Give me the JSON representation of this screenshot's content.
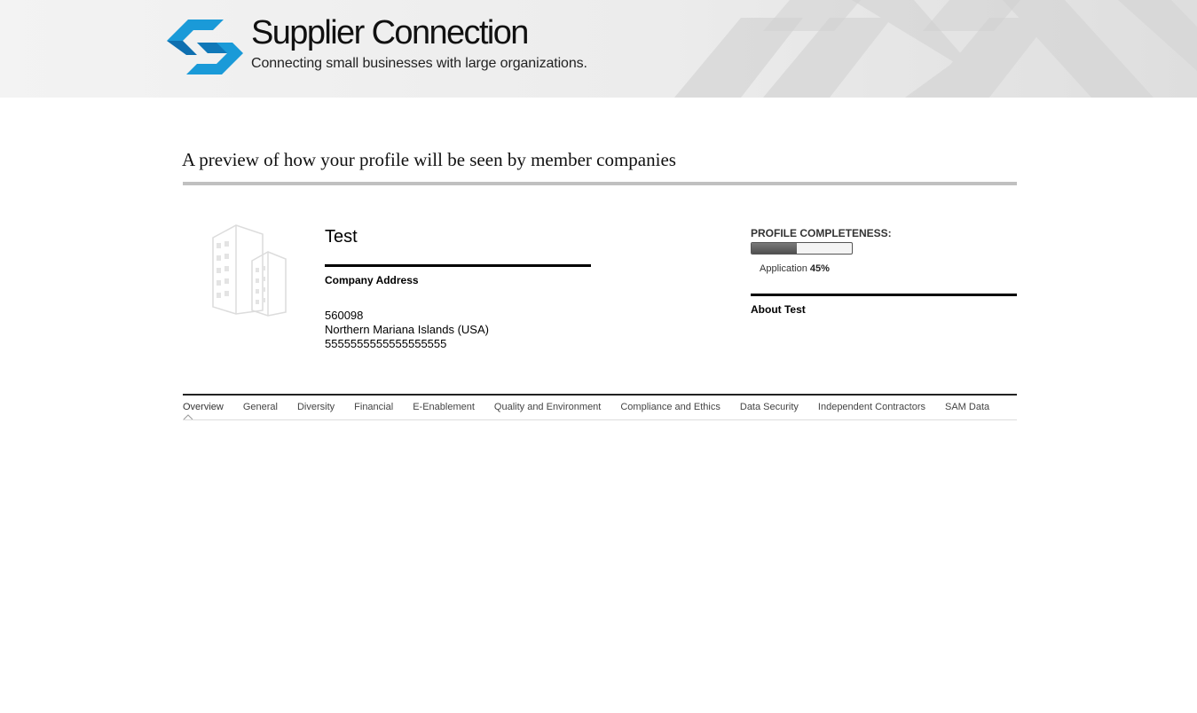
{
  "header": {
    "brand_title": "Supplier Connection",
    "brand_tagline": "Connecting small businesses with large organizations.",
    "logo_icon": "supplier-connection-logo-icon"
  },
  "page": {
    "title": "A preview of how your profile will be seen by member companies"
  },
  "profile": {
    "company_name": "Test",
    "address_label": "Company Address",
    "address_lines": [
      "560098",
      "Northern Mariana Islands (USA)",
      "5555555555555555555"
    ],
    "image_icon": "building-placeholder-icon"
  },
  "completeness": {
    "label": "PROFILE COMPLETENESS:",
    "caption_prefix": "Application",
    "percent_text": "45%",
    "percent_value": 0.45
  },
  "about": {
    "title": "About Test"
  },
  "tabs": [
    {
      "label": "Overview",
      "active": true
    },
    {
      "label": "General",
      "active": false
    },
    {
      "label": "Diversity",
      "active": false
    },
    {
      "label": "Financial",
      "active": false
    },
    {
      "label": "E-Enablement",
      "active": false
    },
    {
      "label": "Quality and Environment",
      "active": false
    },
    {
      "label": "Compliance and Ethics",
      "active": false
    },
    {
      "label": "Data Security",
      "active": false
    },
    {
      "label": "Independent Contractors",
      "active": false
    },
    {
      "label": "SAM Data",
      "active": false
    }
  ],
  "colors": {
    "logo_blue": "#1a9ad8",
    "logo_dark_blue": "#0e6fb0",
    "rule_gray": "#c0c0c0"
  }
}
